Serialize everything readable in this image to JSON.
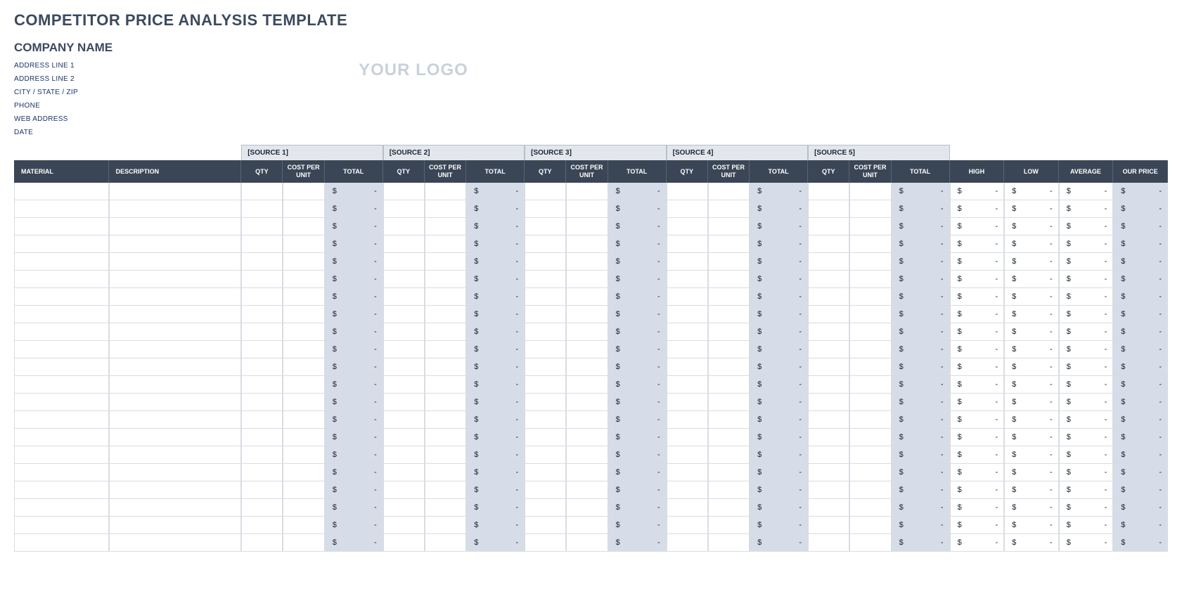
{
  "title": "COMPETITOR PRICE ANALYSIS TEMPLATE",
  "company": {
    "name": "COMPANY NAME",
    "lines": [
      "ADDRESS LINE 1",
      "ADDRESS LINE 2",
      "CITY / STATE / ZIP",
      "PHONE",
      "WEB ADDRESS",
      "DATE"
    ]
  },
  "logo_text": "YOUR LOGO",
  "sources": [
    "[SOURCE 1]",
    "[SOURCE 2]",
    "[SOURCE 3]",
    "[SOURCE 4]",
    "[SOURCE 5]"
  ],
  "columns": {
    "material": "MATERIAL",
    "description": "DESCRIPTION",
    "qty": "QTY",
    "cost_per_unit": "COST PER UNIT",
    "total": "TOTAL",
    "high": "HIGH",
    "low": "LOW",
    "average": "AVERAGE",
    "our_price": "OUR PRICE"
  },
  "currency_symbol": "$",
  "empty_value": "-",
  "row_count": 21
}
